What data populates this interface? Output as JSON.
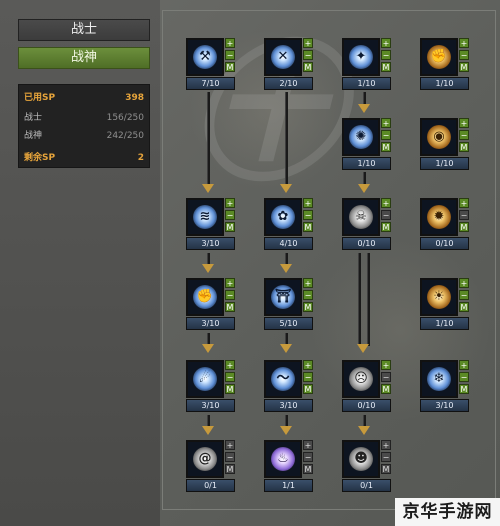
{
  "tabs": {
    "warrior": "战士",
    "god": "战神"
  },
  "sp": {
    "used_label": "已用SP",
    "used_value": "398",
    "warrior_label": "战士",
    "warrior_value": "156/250",
    "god_label": "战神",
    "god_value": "242/250",
    "remain_label": "剩余SP",
    "remain_value": "2"
  },
  "skills": [
    {
      "id": "r1c1",
      "level": "7/10",
      "icon": "hammer-swing-icon"
    },
    {
      "id": "r1c2",
      "level": "2/10",
      "icon": "axe-swing-icon"
    },
    {
      "id": "r1c3",
      "level": "1/10",
      "icon": "shield-burst-icon"
    },
    {
      "id": "r1c4",
      "level": "1/10",
      "icon": "fire-fist-icon"
    },
    {
      "id": "r2c3",
      "level": "1/10",
      "icon": "spirit-icon"
    },
    {
      "id": "r2c4",
      "level": "1/10",
      "icon": "golden-guard-icon"
    },
    {
      "id": "r3c1",
      "level": "3/10",
      "icon": "wind-blade-icon"
    },
    {
      "id": "r3c2",
      "level": "4/10",
      "icon": "paw-strike-icon"
    },
    {
      "id": "r3c3",
      "level": "0/10",
      "icon": "skull-icon"
    },
    {
      "id": "r3c4",
      "level": "0/10",
      "icon": "flame-burst-icon"
    },
    {
      "id": "r4c1",
      "level": "3/10",
      "icon": "smash-icon"
    },
    {
      "id": "r4c2",
      "level": "5/10",
      "icon": "pillar-icon"
    },
    {
      "id": "r4c4",
      "level": "1/10",
      "icon": "sun-aura-icon"
    },
    {
      "id": "r5c1",
      "level": "3/10",
      "icon": "vortex-icon"
    },
    {
      "id": "r5c2",
      "level": "3/10",
      "icon": "wave-icon"
    },
    {
      "id": "r5c3",
      "level": "0/10",
      "icon": "demon-face-icon"
    },
    {
      "id": "r5c4",
      "level": "3/10",
      "icon": "frost-hands-icon"
    },
    {
      "id": "r6c1",
      "level": "0/1",
      "icon": "cyclone-icon"
    },
    {
      "id": "r6c2",
      "level": "1/1",
      "icon": "purple-flame-icon"
    },
    {
      "id": "r6c3",
      "level": "0/1",
      "icon": "beast-face-icon"
    }
  ],
  "buttons": {
    "plus": "+",
    "minus": "−",
    "max": "M"
  },
  "watermark": "京华手游网"
}
